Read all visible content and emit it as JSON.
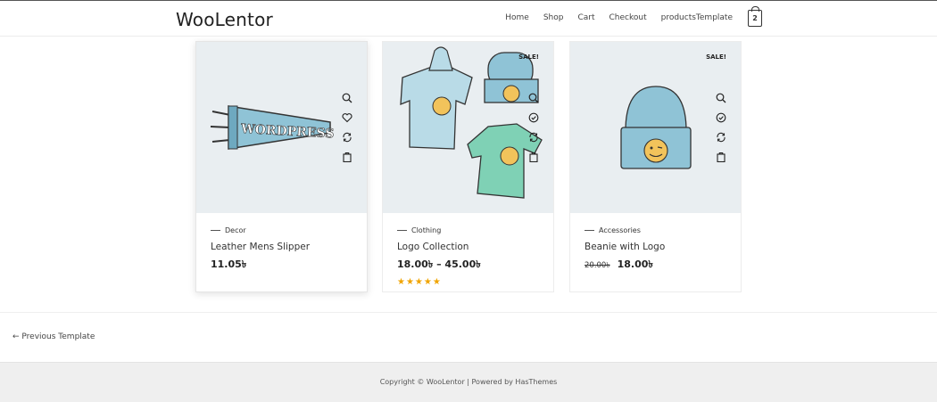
{
  "header": {
    "logo": "WooLentor",
    "nav": [
      "Home",
      "Shop",
      "Cart",
      "Checkout",
      "productsTemplate"
    ],
    "cart_count": "2"
  },
  "products": [
    {
      "category": "Decor",
      "title": "Leather Mens Slipper",
      "price": "11.05৳",
      "sale": "",
      "icons": [
        "search-icon",
        "heart-icon",
        "compare-icon",
        "bag-icon"
      ]
    },
    {
      "category": "Clothing",
      "title": "Logo Collection",
      "price": "18.00৳ – 45.00৳",
      "sale": "SALE!",
      "rating": "★★★★★",
      "icons": [
        "search-icon",
        "check-circle-icon",
        "compare-icon",
        "bag-icon"
      ]
    },
    {
      "category": "Accessories",
      "title": "Beanie with Logo",
      "old_price": "20.00৳",
      "price": "18.00৳",
      "sale": "SALE!",
      "icons": [
        "search-icon",
        "check-circle-icon",
        "compare-icon",
        "bag-icon"
      ]
    }
  ],
  "pagination": {
    "prev": "← Previous Template"
  },
  "footer": {
    "copyright": "Copyright © WooLentor | Powered by HasThemes"
  },
  "colors": {
    "image_bg": "#e9eef1",
    "star": "#f0a400",
    "footer_bg": "#efefef"
  }
}
